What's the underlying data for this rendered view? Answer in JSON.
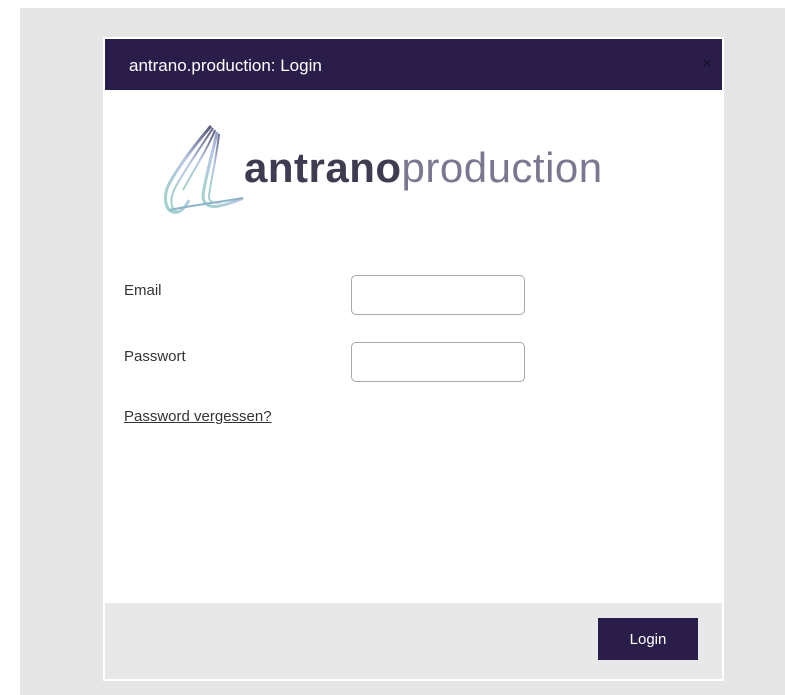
{
  "dialog": {
    "title": "antrano.production: Login",
    "close_label": "×"
  },
  "logo": {
    "word_bold": "antrano",
    "word_light": "production"
  },
  "form": {
    "email_label": "Email",
    "email_value": "",
    "password_label": "Passwort",
    "password_value": "",
    "forgot_link": "Password vergessen?"
  },
  "footer": {
    "login_label": "Login"
  },
  "colors": {
    "accent": "#2a1d4a",
    "backdrop": "#e5e5e5",
    "footer": "#e8e8e8"
  }
}
